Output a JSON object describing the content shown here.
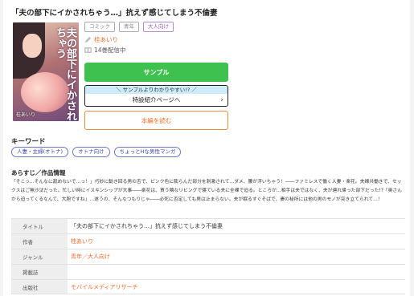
{
  "title": "「夫の部下にイかされちゃう…」抗えず感じてしまう不倫妻",
  "cover": {
    "title_text": "夫の部下にイかされちゃう",
    "author_text": "桂あいり"
  },
  "tags": [
    "コミック",
    "青年",
    "大人向け"
  ],
  "author": "桂あいり",
  "volumes": "14巻配信中",
  "icons": {
    "author": "pen-icon",
    "volumes": "book-icon",
    "chevron": "chevron-right-icon"
  },
  "buttons": {
    "sample": "サンプル",
    "special_strip": "＼ サンプルよりわかりやすい!? ／",
    "special_main": "特設紹介ページへ",
    "read": "本編を読む"
  },
  "keywords": {
    "heading": "キーワード",
    "items": [
      "人妻・主婦(オトナ)",
      "オトナ向け",
      "ちょっとHな男性マンガ"
    ]
  },
  "synopsis": {
    "heading": "あらすじ／作品情報",
    "text": "「そこっ…そんなに舐めないで…っ！」巧妙に動き回る男の舌で、ピンク色に膨らんだ部分を刺激されて…ダメ、腰が浮いちゃう！――ファミレスで働く人妻・楽花。夫婦共働きで、セックスはご無沙汰だった。忙しい時にイスキンシップが大事――楽花は、買う隣なリビングで寝ている夫に全裸で迫る。ところが…相手は夫ではなく、夫が連れ帰った部下だった!?「奥さんから迫ってくるなんて、大胆ですね」…遂うの、そんなつもりじゃ――必死に否定しても男は止まらない。夫が眠るすぐそばで、妻の秘所には他の男のモノが突き立てられて…！"
  },
  "info": {
    "rows": [
      {
        "label": "タイトル",
        "value": "「夫の部下にイかされちゃう…」抗えず感じてしまう不倫妻",
        "link": false
      },
      {
        "label": "作者",
        "value": "桂あいり",
        "link": true
      },
      {
        "label": "ジャンル",
        "value": "青年／大人向け",
        "link": true
      },
      {
        "label": "掲載誌",
        "value": "",
        "link": false
      },
      {
        "label": "出版社",
        "value": "モバイルメディアリサーチ",
        "link": true
      }
    ]
  },
  "colors": {
    "sample_button": "#3fc14f",
    "read_button": "#f07020",
    "keyword_border": "#6d78c9",
    "link": "#f06a2a"
  }
}
